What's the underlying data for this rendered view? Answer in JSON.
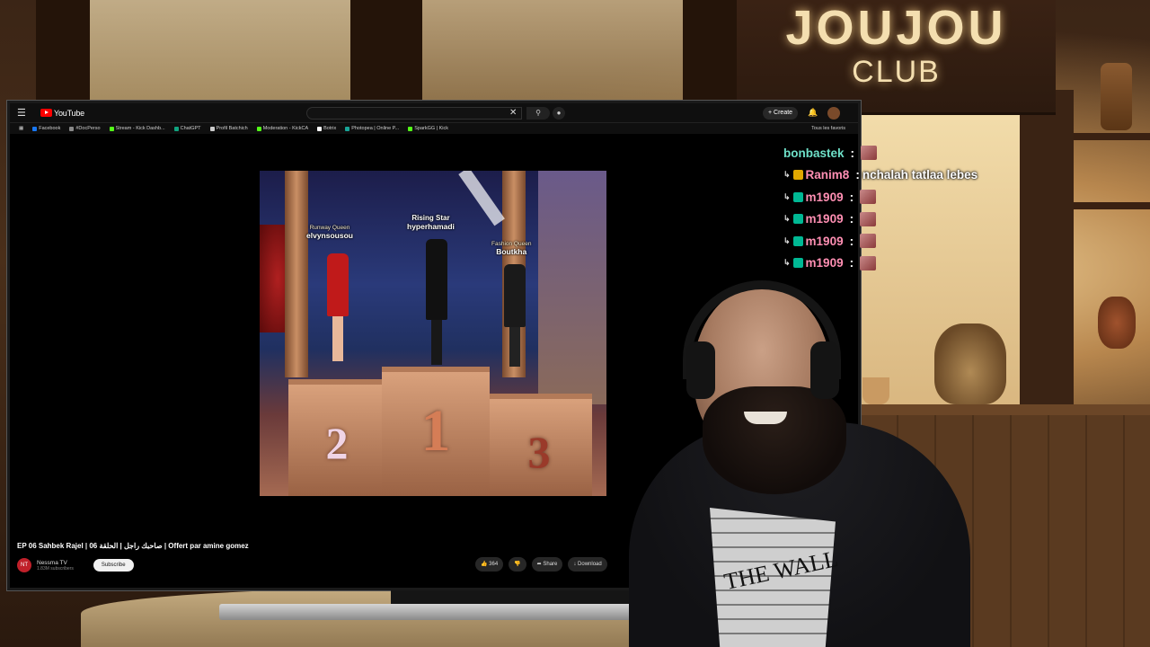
{
  "stream_overlay": {
    "sign_line1": "JOUJOU",
    "sign_line2": "CLUB"
  },
  "browser": {
    "site_name": "YouTube",
    "search_value": "",
    "create_label": "Create",
    "bookmarks": [
      {
        "label": "Facebook",
        "color": "#1877f2"
      },
      {
        "label": "#DocPerso",
        "color": "#888888"
      },
      {
        "label": "Stream - Kick Dashb...",
        "color": "#53fc18"
      },
      {
        "label": "ChatGPT",
        "color": "#10a37f"
      },
      {
        "label": "Profil Batchich",
        "color": "#cccccc"
      },
      {
        "label": "Moderation - KickCA",
        "color": "#53fc18"
      },
      {
        "label": "Botrix",
        "color": "#ffffff"
      },
      {
        "label": "Photopea | Online P...",
        "color": "#18a497"
      },
      {
        "label": "SparkGG | Kick",
        "color": "#53fc18"
      }
    ],
    "bookmarks_right": "Tous les favoris"
  },
  "video": {
    "podium": [
      {
        "title": "Runway Queen",
        "name": "elvynsousou",
        "place": "2"
      },
      {
        "title": "Rising Star",
        "name": "hyperhamadi",
        "place": "1"
      },
      {
        "title": "Fashion Queen",
        "name": "Boutkha",
        "place": "3"
      }
    ],
    "title": "EP 06 Sahbek Rajel | صاحبك راجل | الحلقة 06 | Offert par amine gomez",
    "channel_name": "Nessma TV",
    "channel_subs": "1.83M subscribers",
    "channel_avatar_text": "NT",
    "subscribe_label": "Subscribe",
    "like_count": "364",
    "share_label": "Share",
    "download_label": "Download"
  },
  "chat": [
    {
      "user": "bonbastek",
      "color": "#6ee0c8",
      "badges": [],
      "message": "",
      "emote": true
    },
    {
      "user": "Ranim8",
      "color": "#ff8fb3",
      "badges": [
        "arrow",
        "crown"
      ],
      "message": "nchalah tatlaa lebes",
      "emote": false
    },
    {
      "user": "m1909",
      "color": "#ff8fb3",
      "badges": [
        "arrow",
        "mod"
      ],
      "message": "",
      "emote": true
    },
    {
      "user": "m1909",
      "color": "#ff8fb3",
      "badges": [
        "arrow",
        "mod"
      ],
      "message": "",
      "emote": true
    },
    {
      "user": "m1909",
      "color": "#ff8fb3",
      "badges": [
        "arrow",
        "mod"
      ],
      "message": "",
      "emote": true
    },
    {
      "user": "m1909",
      "color": "#ff8fb3",
      "badges": [
        "arrow",
        "mod"
      ],
      "message": "",
      "emote": true
    }
  ],
  "webcam": {
    "shirt_text": "THE WALL"
  }
}
